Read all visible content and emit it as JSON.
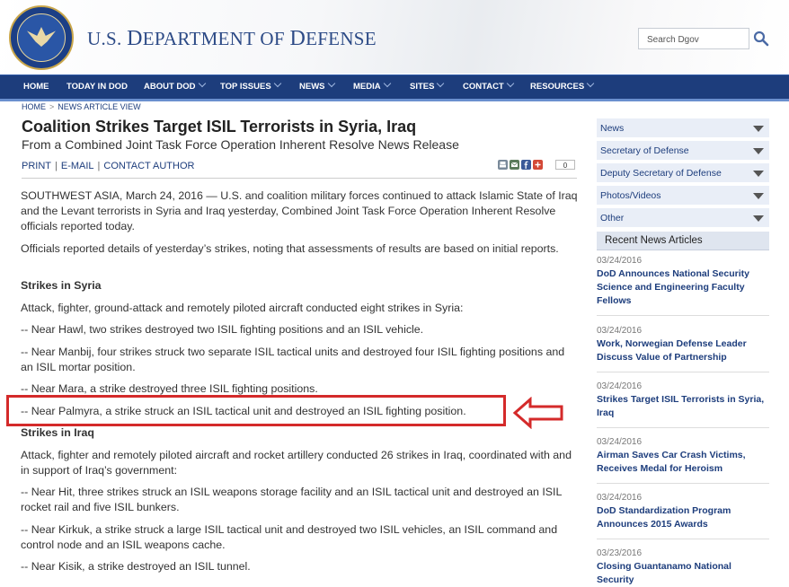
{
  "header": {
    "site_title_parts": [
      "U.S. ",
      "D",
      "EPARTMENT OF ",
      "D",
      "EFENSE"
    ],
    "seal_text": "DEPARTMENT OF DEFENSE · UNITED STATES OF AMERICA",
    "search_placeholder": "Search Dgov",
    "search_icon": "magnifier"
  },
  "nav": {
    "items": [
      {
        "label": "HOME",
        "dropdown": false
      },
      {
        "label": "TODAY IN DOD",
        "dropdown": false
      },
      {
        "label": "ABOUT DOD",
        "dropdown": true
      },
      {
        "label": "TOP ISSUES",
        "dropdown": true
      },
      {
        "label": "NEWS",
        "dropdown": true
      },
      {
        "label": "MEDIA",
        "dropdown": true
      },
      {
        "label": "SITES",
        "dropdown": true
      },
      {
        "label": "CONTACT",
        "dropdown": true
      },
      {
        "label": "RESOURCES",
        "dropdown": true
      }
    ]
  },
  "breadcrumb": {
    "home": "HOME",
    "sep": ">",
    "current": "NEWS ARTICLE VIEW"
  },
  "article": {
    "title": "Coalition Strikes Target ISIL Terrorists in Syria, Iraq",
    "subtitle": "From a Combined Joint Task Force Operation Inherent Resolve News Release",
    "tools": {
      "print": "PRINT",
      "sep": "|",
      "email": "E-MAIL",
      "contact": "CONTACT AUTHOR"
    },
    "share_icons": [
      "print-icon",
      "email-icon",
      "facebook-icon",
      "google-plus-icon"
    ],
    "share_count": "0",
    "paragraphs": [
      {
        "text": "SOUTHWEST ASIA, March 24, 2016 — U.S. and coalition military forces continued to attack Islamic State of Iraq and the Levant terrorists in Syria and Iraq yesterday, Combined Joint Task Force Operation Inherent Resolve officials reported today.",
        "heading": false
      },
      {
        "text": "Officials reported details of yesterday’s strikes, noting that assessments of results are based on initial reports.",
        "heading": false
      },
      {
        "text": "Strikes in Syria",
        "heading": true
      },
      {
        "text": "Attack, fighter, ground-attack and remotely piloted aircraft conducted eight strikes in Syria:",
        "heading": false
      },
      {
        "text": "-- Near Hawl, two strikes destroyed two ISIL fighting positions and an ISIL vehicle.",
        "heading": false
      },
      {
        "text": "-- Near Manbij, four strikes struck two separate ISIL tactical units and destroyed four ISIL fighting positions and an ISIL mortar position.",
        "heading": false
      },
      {
        "text": "-- Near Mara, a strike destroyed three ISIL fighting positions.",
        "heading": false
      },
      {
        "text": "-- Near Palmyra, a strike struck an ISIL tactical unit and destroyed an ISIL fighting position.",
        "heading": false
      },
      {
        "text": "Strikes in Iraq",
        "heading": true
      },
      {
        "text": "Attack, fighter and remotely piloted aircraft and rocket artillery conducted 26 strikes in Iraq, coordinated with and in support of Iraq’s government:",
        "heading": false
      },
      {
        "text": "-- Near Hit, three strikes struck an ISIL weapons storage facility and an ISIL tactical unit and destroyed an ISIL rocket rail and five ISIL bunkers.",
        "heading": false
      },
      {
        "text": "-- Near Kirkuk, a strike struck a large ISIL tactical unit and destroyed two ISIL vehicles, an ISIL command and control node and an ISIL weapons cache.",
        "heading": false
      },
      {
        "text": "-- Near Kisik, a strike destroyed an ISIL tunnel.",
        "heading": false
      }
    ]
  },
  "annotation": {
    "highlight_color": "#d42a2a",
    "arrow": "left-pointing outline arrow"
  },
  "sidebar": {
    "items": [
      "News",
      "Secretary of Defense",
      "Deputy Secretary of Defense",
      "Photos/Videos",
      "Other"
    ],
    "recent_header": "Recent News Articles",
    "recent": [
      {
        "date": "03/24/2016",
        "title": "DoD Announces National Security Science and Engineering Faculty Fellows"
      },
      {
        "date": "03/24/2016",
        "title": "Work, Norwegian Defense Leader Discuss Value of Partnership"
      },
      {
        "date": "03/24/2016",
        "title": "Strikes Target ISIL Terrorists in Syria, Iraq"
      },
      {
        "date": "03/24/2016",
        "title": "Airman Saves Car Crash Victims, Receives Medal for Heroism"
      },
      {
        "date": "03/24/2016",
        "title": "DoD Standardization Program Announces 2015 Awards"
      },
      {
        "date": "03/23/2016",
        "title": "Closing Guantanamo National Security"
      }
    ]
  },
  "colors": {
    "nav_bg": "#1d3d7c",
    "link": "#1d3d7c",
    "sidebar_bg": "#e9eef7"
  }
}
